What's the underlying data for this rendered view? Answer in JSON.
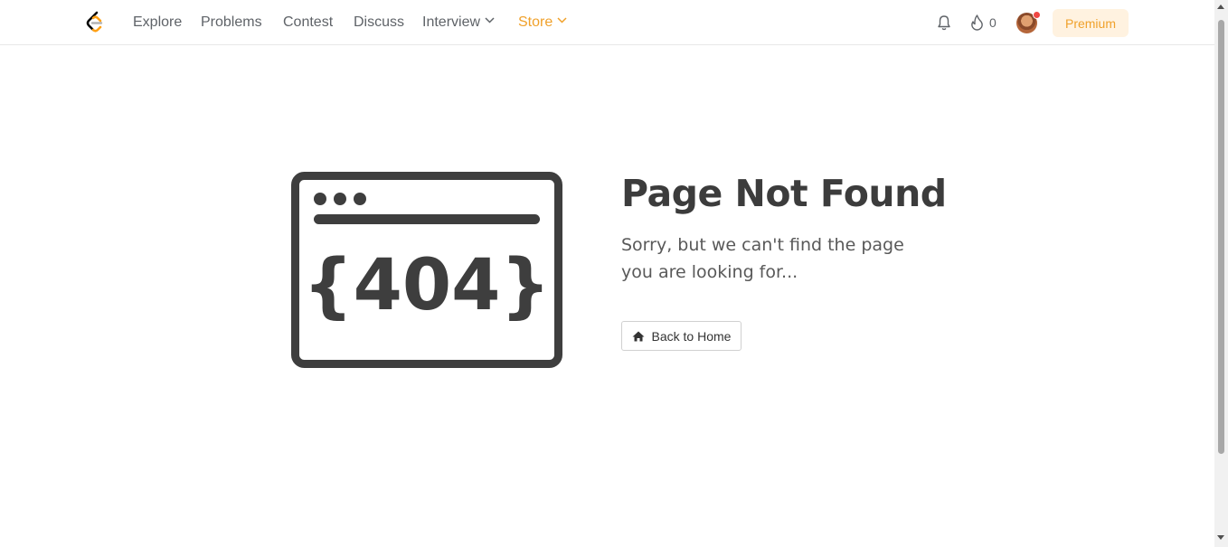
{
  "nav": {
    "logo": "leetcode-logo",
    "links": [
      {
        "label": "Explore"
      },
      {
        "label": "Problems"
      },
      {
        "label": "Contest"
      },
      {
        "label": "Discuss"
      },
      {
        "label": "Interview"
      },
      {
        "label": "Store"
      }
    ],
    "streak_count": "0",
    "premium_label": "Premium",
    "accent_color": "#f0a12b"
  },
  "main": {
    "title": "Page Not Found",
    "subtitle": "Sorry, but we can't find the page you are looking for...",
    "illustration_text": "{404}",
    "back_button_label": "Back to Home"
  }
}
